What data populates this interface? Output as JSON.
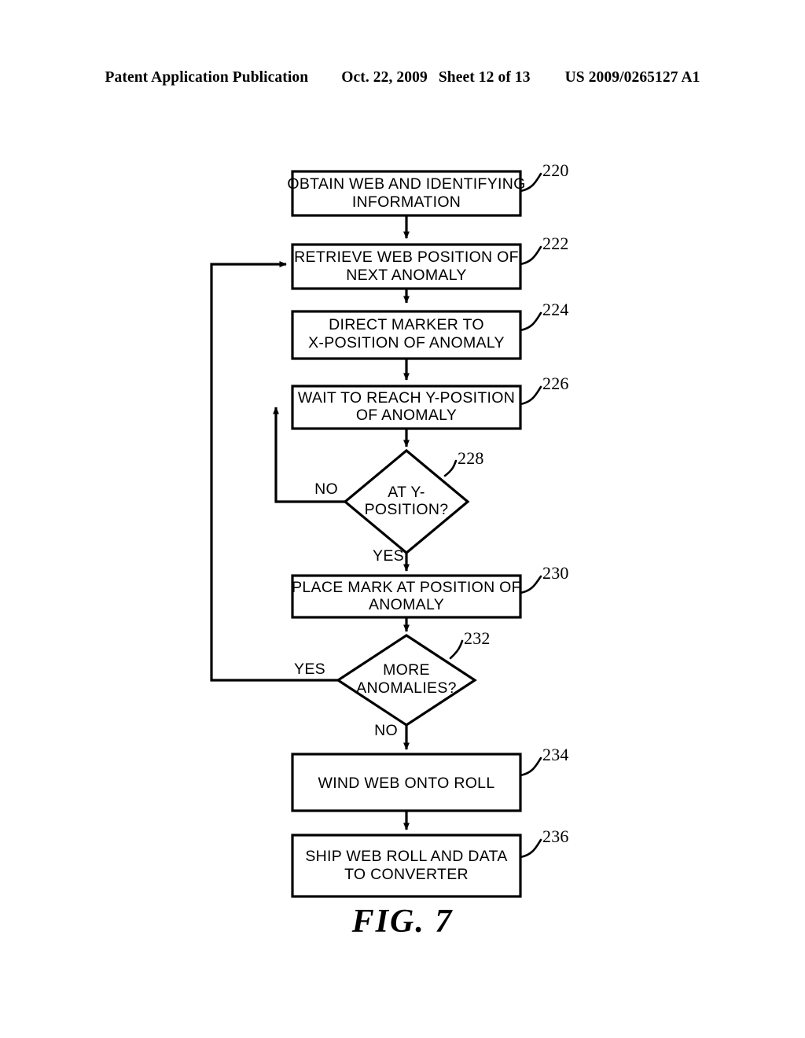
{
  "header": {
    "publication": "Patent Application Publication",
    "date": "Oct. 22, 2009",
    "sheet": "Sheet 12 of 13",
    "patent_number": "US 2009/0265127 A1"
  },
  "figure": {
    "caption": "FIG. 7"
  },
  "flowchart": {
    "nodes": [
      {
        "ref": "220",
        "shape": "box",
        "lines": [
          "OBTAIN WEB AND IDENTIFYING",
          "INFORMATION"
        ]
      },
      {
        "ref": "222",
        "shape": "box",
        "lines": [
          "RETRIEVE WEB POSITION OF",
          "NEXT ANOMALY"
        ]
      },
      {
        "ref": "224",
        "shape": "box",
        "lines": [
          "DIRECT MARKER TO",
          "X-POSITION OF ANOMALY"
        ]
      },
      {
        "ref": "226",
        "shape": "box",
        "lines": [
          "WAIT TO REACH Y-POSITION",
          "OF ANOMALY"
        ]
      },
      {
        "ref": "228",
        "shape": "diamond",
        "lines": [
          "AT Y-",
          "POSITION?"
        ]
      },
      {
        "ref": "230",
        "shape": "box",
        "lines": [
          "PLACE MARK AT POSITION OF",
          "ANOMALY"
        ]
      },
      {
        "ref": "232",
        "shape": "diamond",
        "lines": [
          "MORE",
          "ANOMALIES?"
        ]
      },
      {
        "ref": "234",
        "shape": "box",
        "lines": [
          "WIND WEB ONTO ROLL"
        ]
      },
      {
        "ref": "236",
        "shape": "box",
        "lines": [
          "SHIP WEB ROLL AND DATA",
          "TO CONVERTER"
        ]
      }
    ],
    "branch_labels": {
      "at_y_position_no": "NO",
      "at_y_position_yes": "YES",
      "more_anomalies_yes": "YES",
      "more_anomalies_no": "NO"
    }
  },
  "colors": {
    "ink": "#000000",
    "paper": "#ffffff"
  }
}
